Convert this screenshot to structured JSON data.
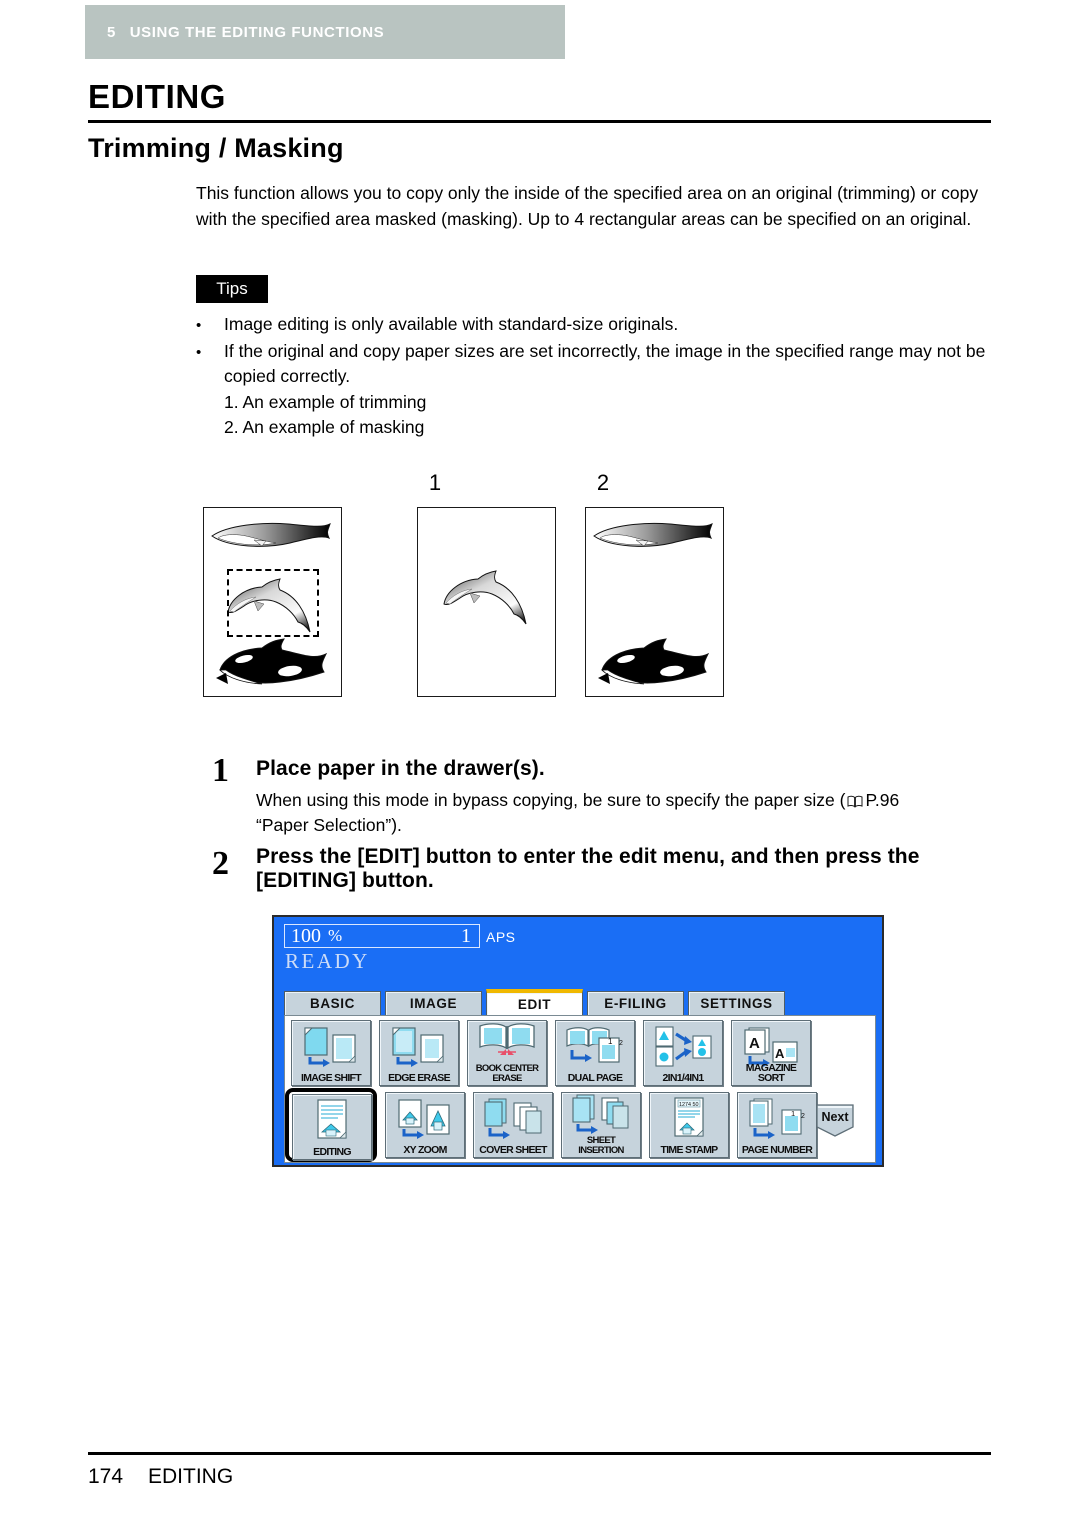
{
  "chapter": {
    "number": "5",
    "title": "USING THE EDITING FUNCTIONS",
    "bar_color": "#b9c4c1"
  },
  "headings": {
    "h1": "EDITING",
    "h2": "Trimming / Masking"
  },
  "intro": "This function allows you to copy only the inside of the specified area on an original (trimming) or copy with the specified area masked (masking). Up to 4 rectangular areas can be specified on an original.",
  "tips": {
    "badge": "Tips",
    "items": [
      "Image editing is only available with standard-size originals.",
      "If the original and copy paper sizes are set incorrectly, the image in the specified range may not be copied correctly."
    ],
    "sub_items": [
      "1. An example of trimming",
      "2. An example of masking"
    ]
  },
  "illustration": {
    "label_1": "1",
    "label_2": "2",
    "original_caption": "",
    "creatures": [
      "whale",
      "dolphin",
      "orca"
    ]
  },
  "steps": [
    {
      "number": "1",
      "heading": "Place paper in the drawer(s).",
      "body_before": "When using this mode in bypass copying, be sure to specify the paper size (",
      "reference": "P.96",
      "body_after": "“Paper Selection”)."
    },
    {
      "number": "2",
      "heading_line1": "Press the [EDIT] button to enter the edit menu, and then press the",
      "heading_line2": "[EDITING] button."
    }
  ],
  "lcd": {
    "background": "#1a6ef5",
    "zoom_value": "100",
    "zoom_unit": "%",
    "copy_count": "1",
    "paper_mode": "APS",
    "status": "READY",
    "tabs": [
      {
        "label": "BASIC",
        "active": false
      },
      {
        "label": "IMAGE",
        "active": false
      },
      {
        "label": "EDIT",
        "active": true
      },
      {
        "label": "E-FILING",
        "active": false
      },
      {
        "label": "SETTINGS",
        "active": false
      }
    ],
    "active_tab_accent": "#f0b800",
    "row1": [
      {
        "label": "IMAGE SHIFT",
        "icon": "image-shift-icon"
      },
      {
        "label": "EDGE ERASE",
        "icon": "edge-erase-icon"
      },
      {
        "label_l1": "BOOK CENTER",
        "label_l2": "ERASE",
        "icon": "book-center-erase-icon"
      },
      {
        "label": "DUAL  PAGE",
        "icon": "dual-page-icon"
      },
      {
        "label": "2IN1/4IN1",
        "icon": "2in1-4in1-icon"
      },
      {
        "label": "MAGAZINE SORT",
        "icon": "magazine-sort-icon"
      }
    ],
    "row2": [
      {
        "label": "EDITING",
        "icon": "editing-icon",
        "selected": true
      },
      {
        "label": "XY ZOOM",
        "icon": "xy-zoom-icon"
      },
      {
        "label": "COVER SHEET",
        "icon": "cover-sheet-icon"
      },
      {
        "label_l1": "SHEET",
        "label_l2": "INSERTION",
        "icon": "sheet-insertion-icon"
      },
      {
        "label": "TIME STAMP",
        "icon": "time-stamp-icon"
      },
      {
        "label": "PAGE NUMBER",
        "icon": "page-number-icon"
      }
    ],
    "next_label": "Next",
    "time_stamp_display": "1274 50",
    "dual_page_marks": [
      "1",
      "2"
    ],
    "page_number_marks": [
      "1",
      "2"
    ],
    "magazine_sort_marks": [
      "A",
      "A"
    ]
  },
  "footer": {
    "page_number": "174",
    "section": "EDITING"
  }
}
